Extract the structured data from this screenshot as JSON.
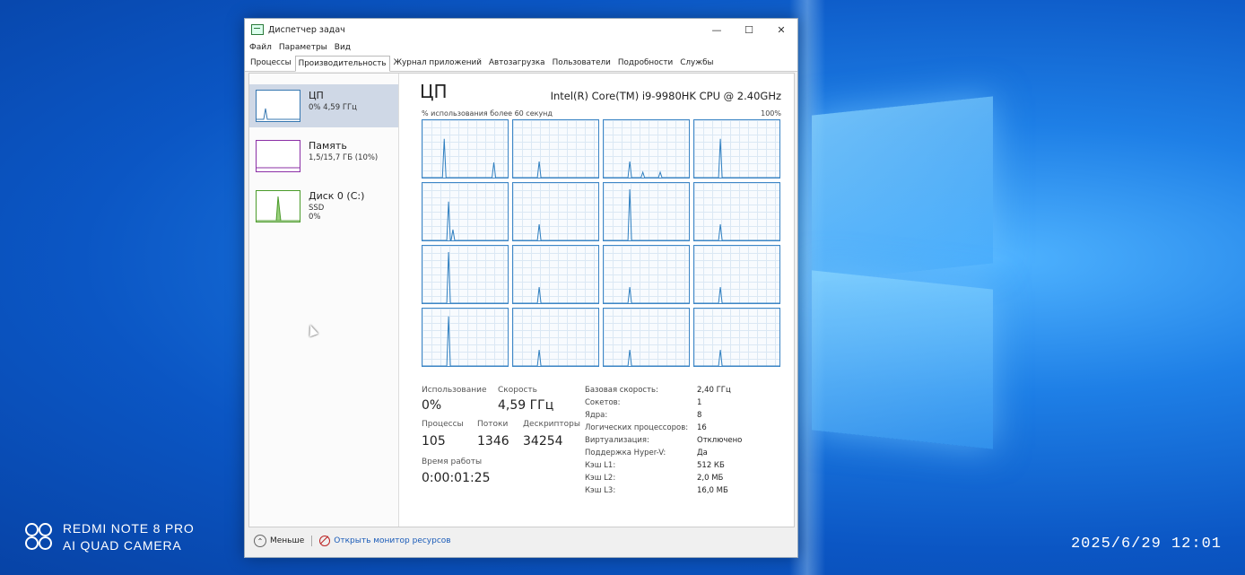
{
  "window": {
    "title": "Диспетчер задач",
    "controls": {
      "minimize": "—",
      "maximize": "☐",
      "close": "✕"
    }
  },
  "menu": [
    "Файл",
    "Параметры",
    "Вид"
  ],
  "tabs": [
    {
      "label": "Процессы",
      "active": false
    },
    {
      "label": "Производительность",
      "active": true
    },
    {
      "label": "Журнал приложений",
      "active": false
    },
    {
      "label": "Автозагрузка",
      "active": false
    },
    {
      "label": "Пользователи",
      "active": false
    },
    {
      "label": "Подробности",
      "active": false
    },
    {
      "label": "Службы",
      "active": false
    }
  ],
  "sidebar": {
    "items": [
      {
        "title": "ЦП",
        "sub": "0% 4,59 ГГц",
        "sub2": "",
        "color": "#3677b1"
      },
      {
        "title": "Память",
        "sub": "1,5/15,7 ГБ (10%)",
        "sub2": "",
        "color": "#8b2fa6"
      },
      {
        "title": "Диск 0 (C:)",
        "sub": "SSD",
        "sub2": "0%",
        "color": "#4b9b2a"
      }
    ]
  },
  "main": {
    "heading": "ЦП",
    "cpu_model": "Intel(R) Core(TM) i9-9980HK CPU @ 2.40GHz",
    "graph_label": "% использования более 60 секунд",
    "graph_max": "100%",
    "stats": {
      "usage_label": "Использование",
      "usage_value": "0%",
      "speed_label": "Скорость",
      "speed_value": "4,59 ГГц",
      "processes_label": "Процессы",
      "processes_value": "105",
      "threads_label": "Потоки",
      "threads_value": "1346",
      "handles_label": "Дескрипторы",
      "handles_value": "34254",
      "uptime_label": "Время работы",
      "uptime_value": "0:00:01:25"
    },
    "specs": [
      {
        "key": "Базовая скорость:",
        "value": "2,40 ГГц"
      },
      {
        "key": "Сокетов:",
        "value": "1"
      },
      {
        "key": "Ядра:",
        "value": "8"
      },
      {
        "key": "Логических процессоров:",
        "value": "16"
      },
      {
        "key": "Виртуализация:",
        "value": "Отключено"
      },
      {
        "key": "Поддержка Hyper-V:",
        "value": "Да"
      },
      {
        "key": "Кэш L1:",
        "value": "512 КБ"
      },
      {
        "key": "Кэш L2:",
        "value": "2,0 МБ"
      },
      {
        "key": "Кэш L3:",
        "value": "16,0 МБ"
      }
    ]
  },
  "footer": {
    "fewer": "Меньше",
    "monitor": "Открыть монитор ресурсов"
  },
  "camera": {
    "line1": "REDMI NOTE 8 PRO",
    "line2": "AI QUAD CAMERA",
    "datetime": "2025/6/29  12:01"
  }
}
